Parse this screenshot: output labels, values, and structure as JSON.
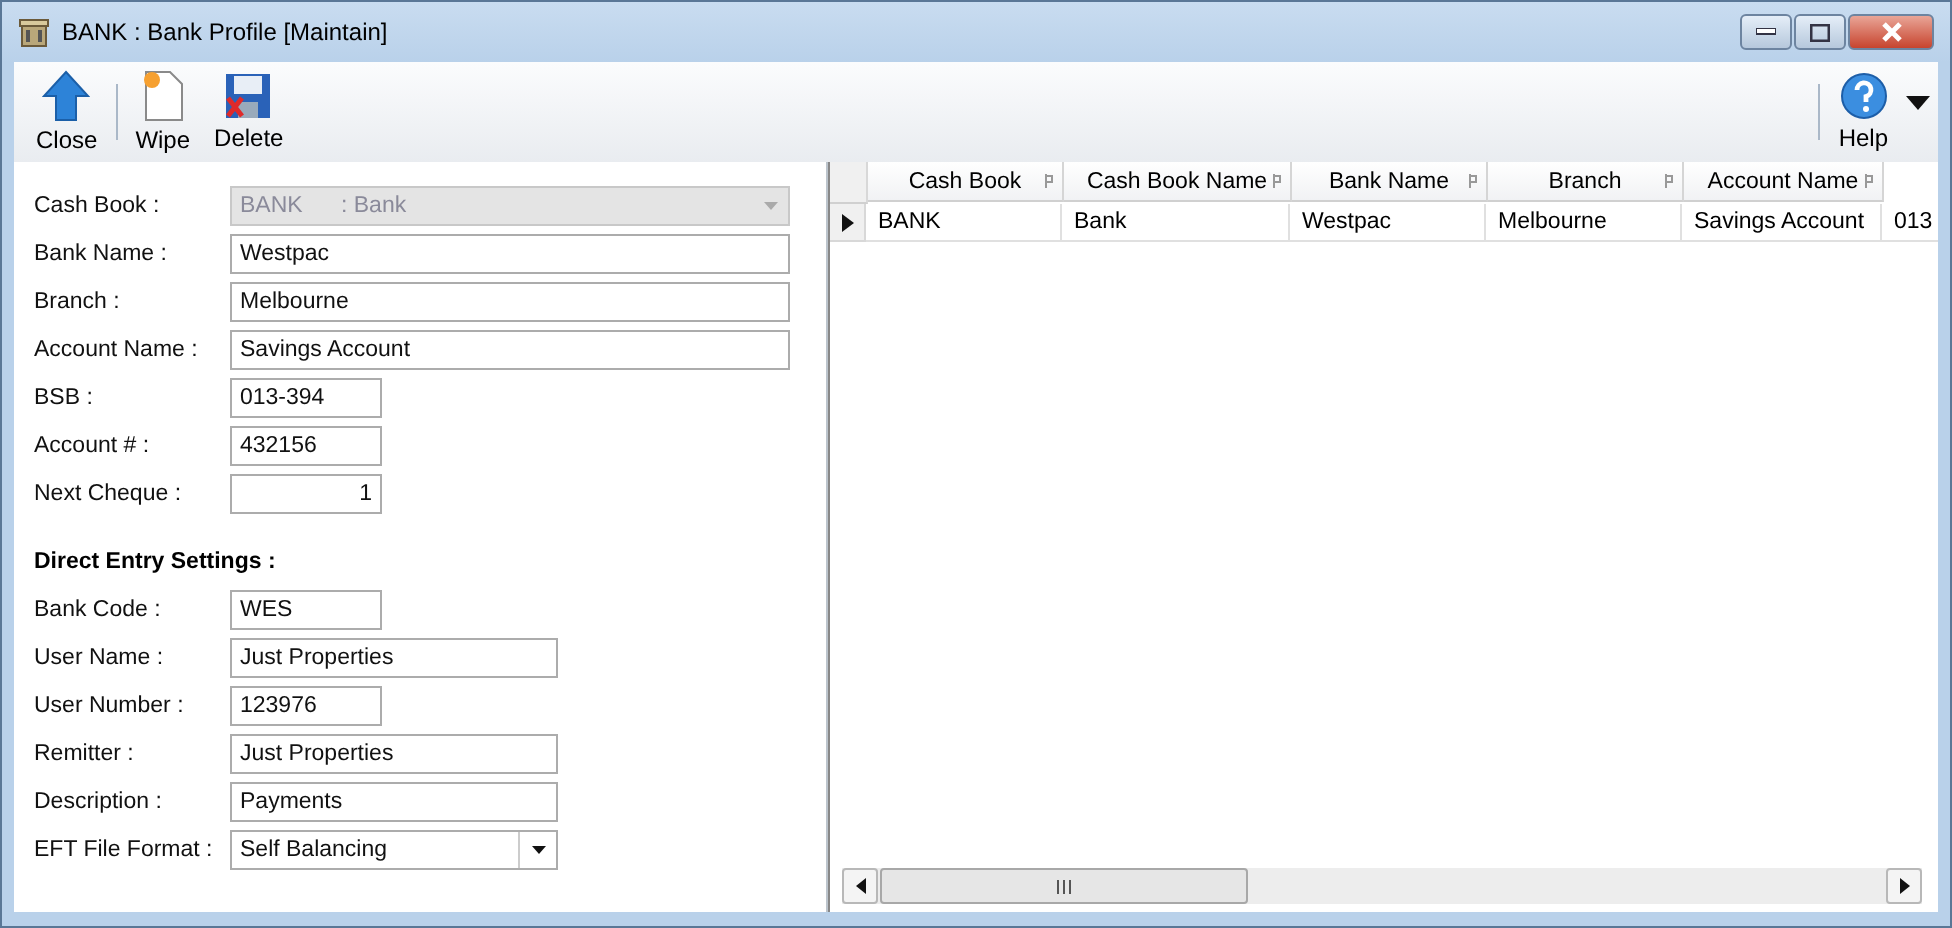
{
  "window": {
    "title": "BANK : Bank Profile [Maintain]"
  },
  "toolbar": [
    {
      "label": "Close",
      "kind": "close"
    },
    {
      "label": "Wipe",
      "kind": "wipe"
    },
    {
      "label": "Delete",
      "kind": "delete"
    }
  ],
  "help": {
    "label": "Help"
  },
  "form": {
    "fields": [
      {
        "label": "Cash Book :",
        "value": "BANK      : Bank",
        "kind": "dropdown",
        "disabled": true
      },
      {
        "label": "Bank Name :",
        "value": "Westpac",
        "kind": "text",
        "disabled": false
      },
      {
        "label": "Branch :",
        "value": "Melbourne",
        "kind": "text",
        "disabled": false
      },
      {
        "label": "Account Name :",
        "value": "Savings Account",
        "kind": "text",
        "disabled": false
      },
      {
        "label": "BSB :",
        "value": "013-394",
        "kind": "text",
        "disabled": false
      },
      {
        "label": "Account # :",
        "value": "432156",
        "kind": "text",
        "disabled": false
      },
      {
        "label": "Next Cheque :",
        "value": "1",
        "kind": "number",
        "disabled": false
      }
    ],
    "section_title": "Direct Entry Settings :",
    "de_fields": [
      {
        "label": "Bank Code :",
        "value": "WES",
        "kind": "text",
        "disabled": false
      },
      {
        "label": "User Name :",
        "value": "Just Properties",
        "kind": "text",
        "disabled": false
      },
      {
        "label": "User Number :",
        "value": "123976",
        "kind": "text",
        "disabled": false
      },
      {
        "label": "Remitter :",
        "value": "Just Properties",
        "kind": "text",
        "disabled": false
      },
      {
        "label": "Description :",
        "value": "Payments",
        "kind": "text",
        "disabled": false
      },
      {
        "label": "EFT File Format :",
        "value": "Self Balancing",
        "kind": "dropdown",
        "disabled": false
      }
    ]
  },
  "table": {
    "columns": [
      "Cash Book",
      "Cash Book Name",
      "Bank Name",
      "Branch",
      "Account Name"
    ],
    "rows": [
      {
        "selected": true,
        "cells": [
          "BANK",
          "Bank",
          "Westpac",
          "Melbourne",
          "Savings Account",
          "013"
        ]
      }
    ]
  }
}
